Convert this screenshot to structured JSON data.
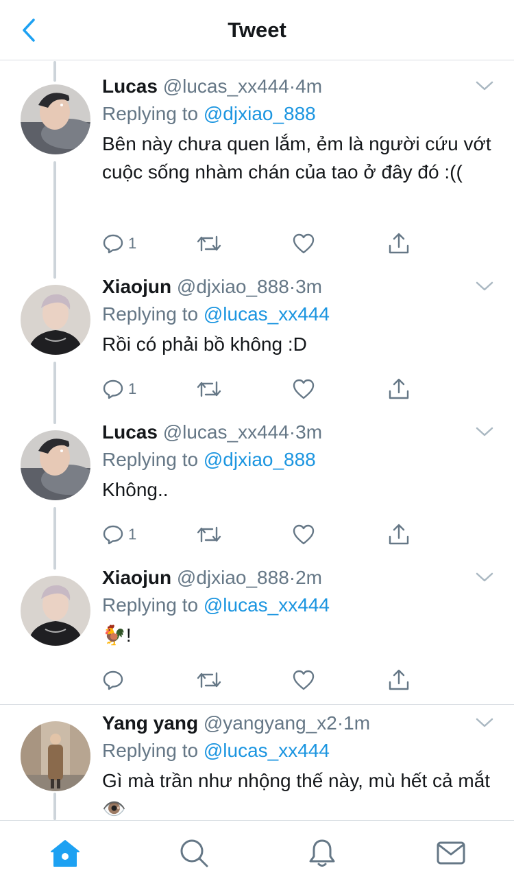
{
  "header": {
    "title": "Tweet",
    "back_icon": "chevron-left-icon",
    "accent_color": "#1da1f2"
  },
  "reply_prefix": "Replying to",
  "tweets": [
    {
      "name": "Lucas",
      "handle": "@lucas_xx444",
      "separator": "·",
      "time": "4m",
      "reply_to": "@djxiao_888",
      "text": "Bên này chưa quen lắm, ẻm là người cứu vớt cuộc sống nhàm chán của tao ở đây đó :((",
      "reply_count": "1",
      "avatar_icon": "avatar-lucas"
    },
    {
      "name": "Xiaojun",
      "handle": "@djxiao_888",
      "separator": "·",
      "time": "3m",
      "reply_to": "@lucas_xx444",
      "text": "Rồi có phải bồ không :D",
      "reply_count": "1",
      "avatar_icon": "avatar-xiaojun"
    },
    {
      "name": "Lucas",
      "handle": "@lucas_xx444",
      "separator": "·",
      "time": "3m",
      "reply_to": "@djxiao_888",
      "text": "Không..",
      "reply_count": "1",
      "avatar_icon": "avatar-lucas"
    },
    {
      "name": "Xiaojun",
      "handle": "@djxiao_888",
      "separator": "·",
      "time": "2m",
      "reply_to": "@lucas_xx444",
      "text": "🐓!",
      "reply_count": "",
      "avatar_icon": "avatar-xiaojun"
    },
    {
      "name": "Yang yang",
      "handle": "@yangyang_x2",
      "separator": "·",
      "time": "1m",
      "reply_to": "@lucas_xx444",
      "text": "Gì mà trần như nhộng thế này, mù hết cả mắt 👁️",
      "reply_count": "",
      "avatar_icon": "avatar-yangyang"
    }
  ],
  "action_icons": [
    "reply-icon",
    "retweet-icon",
    "like-icon",
    "share-icon"
  ],
  "bottom_nav": [
    {
      "name": "home",
      "icon": "home-icon",
      "active": true
    },
    {
      "name": "search",
      "icon": "search-icon",
      "active": false
    },
    {
      "name": "notifications",
      "icon": "bell-icon",
      "active": false
    },
    {
      "name": "messages",
      "icon": "mail-icon",
      "active": false
    }
  ],
  "colors": {
    "text": "#14171a",
    "secondary": "#657786",
    "link": "#1b95e0",
    "divider": "#d8dde2",
    "thread_line": "#cdd4da"
  }
}
